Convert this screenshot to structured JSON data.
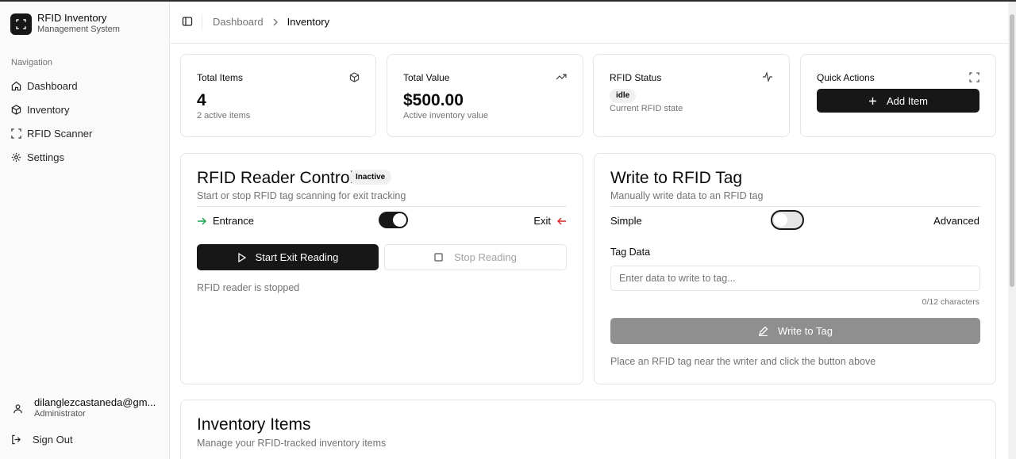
{
  "app": {
    "title": "RFID Inventory",
    "subtitle": "Management System"
  },
  "sidebar": {
    "nav_label": "Navigation",
    "items": [
      {
        "label": "Dashboard",
        "icon": "home-icon"
      },
      {
        "label": "Inventory",
        "icon": "box-icon"
      },
      {
        "label": "RFID Scanner",
        "icon": "scan-icon"
      },
      {
        "label": "Settings",
        "icon": "gear-icon"
      }
    ],
    "user": {
      "email": "dilanglezcastaneda@gm...",
      "role": "Administrator"
    },
    "sign_out": "Sign Out"
  },
  "breadcrumb": {
    "parent": "Dashboard",
    "current": "Inventory"
  },
  "stats": {
    "total_items": {
      "title": "Total Items",
      "value": "4",
      "sub": "2 active items"
    },
    "total_value": {
      "title": "Total Value",
      "value": "$500.00",
      "sub": "Active inventory value"
    },
    "rfid_status": {
      "title": "RFID Status",
      "badge": "idle",
      "sub": "Current RFID state"
    },
    "quick_actions": {
      "title": "Quick Actions",
      "button": "Add Item"
    }
  },
  "reader": {
    "title": "RFID Reader Control",
    "badge": "Inactive",
    "subtitle": "Start or stop RFID tag scanning for exit tracking",
    "entrance_label": "Entrance",
    "exit_label": "Exit",
    "mode_toggle_on": true,
    "start_button": "Start Exit Reading",
    "stop_button": "Stop Reading",
    "status": "RFID reader is stopped"
  },
  "writer": {
    "title": "Write to RFID Tag",
    "subtitle": "Manually write data to an RFID tag",
    "simple_label": "Simple",
    "advanced_label": "Advanced",
    "mode_toggle_on": false,
    "field_label": "Tag Data",
    "placeholder": "Enter data to write to tag...",
    "char_count": "0/12 characters",
    "button": "Write to Tag",
    "hint": "Place an RFID tag near the writer and click the button above"
  },
  "inventory": {
    "title": "Inventory Items",
    "subtitle": "Manage your RFID-tracked inventory items"
  },
  "colors": {
    "accent_dark": "#171717",
    "arrow_green": "#16a34a",
    "arrow_red": "#dc2626",
    "disabled_button": "#8f8f8f"
  }
}
